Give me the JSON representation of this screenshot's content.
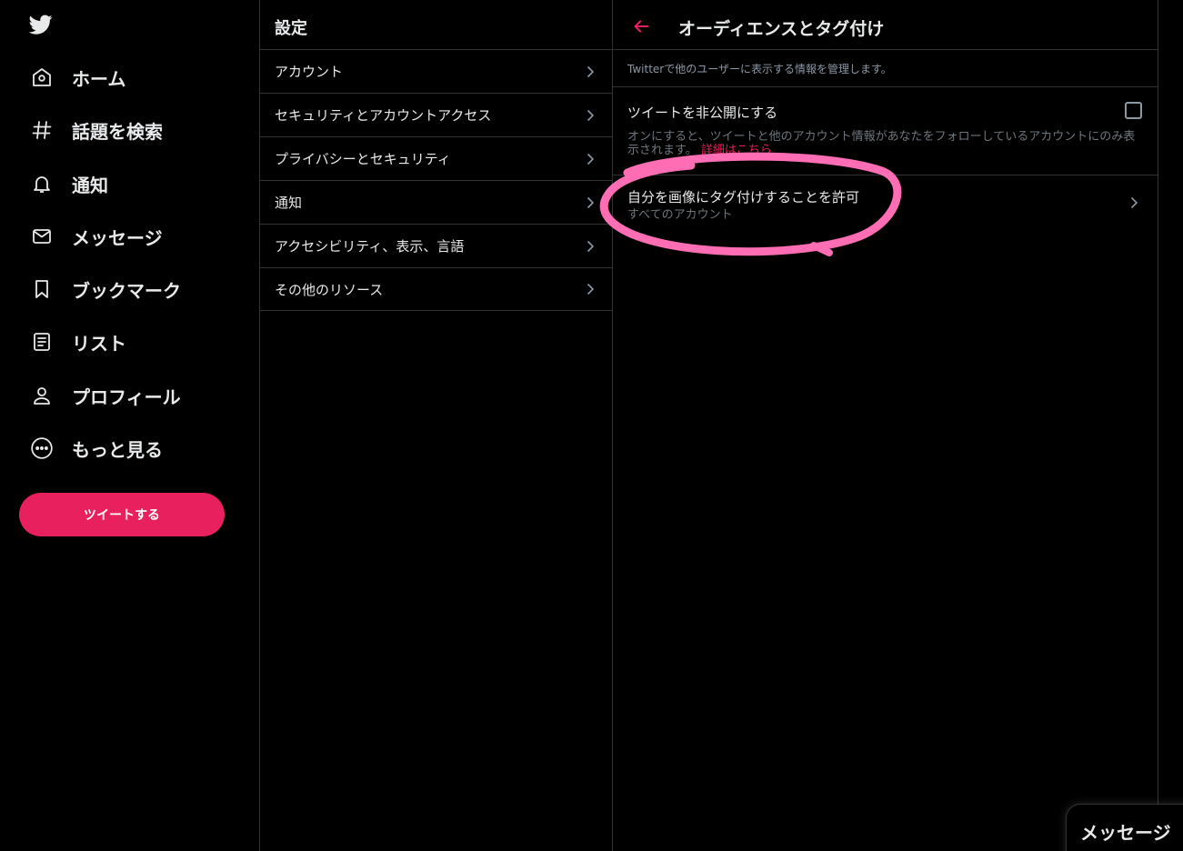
{
  "nav": {
    "items": [
      {
        "label": "ホーム",
        "icon": "home-icon"
      },
      {
        "label": "話題を検索",
        "icon": "hashtag-icon"
      },
      {
        "label": "通知",
        "icon": "bell-icon"
      },
      {
        "label": "メッセージ",
        "icon": "envelope-icon"
      },
      {
        "label": "ブックマーク",
        "icon": "bookmark-icon"
      },
      {
        "label": "リスト",
        "icon": "list-icon"
      },
      {
        "label": "プロフィール",
        "icon": "person-icon"
      },
      {
        "label": "もっと見る",
        "icon": "more-circle-icon"
      }
    ],
    "tweet_button": "ツイートする"
  },
  "settings": {
    "title": "設定",
    "items": [
      {
        "label": "アカウント"
      },
      {
        "label": "セキュリティとアカウントアクセス"
      },
      {
        "label": "プライバシーとセキュリティ"
      },
      {
        "label": "通知"
      },
      {
        "label": "アクセシビリティ、表示、言語"
      },
      {
        "label": "その他のリソース"
      }
    ]
  },
  "detail": {
    "title": "オーディエンスとタグ付け",
    "description": "Twitterで他のユーザーに表示する情報を管理します。",
    "protect": {
      "label": "ツイートを非公開にする",
      "help": "オンにすると、ツイートと他のアカウント情報があなたをフォローしているアカウントにのみ表示されます。",
      "link": "詳細はこちら",
      "checked": false
    },
    "tagging": {
      "label": "自分を画像にタグ付けすることを許可",
      "value": "すべてのアカウント"
    }
  },
  "messages_drawer": {
    "label": "メッセージ"
  },
  "colors": {
    "accent": "#e8205e",
    "background": "#000000",
    "border": "#2f3336",
    "annotation": "#ff6eb4"
  }
}
